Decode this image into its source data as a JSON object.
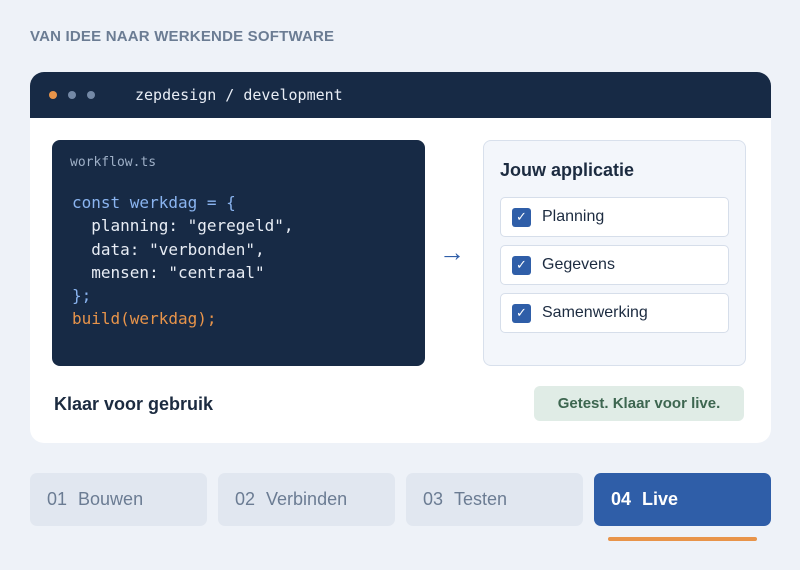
{
  "eyebrow": "VAN IDEE NAAR WERKENDE SOFTWARE",
  "window": {
    "path": "zepdesign / development"
  },
  "code": {
    "filename": "workflow.ts",
    "line1": "const werkdag = {",
    "line2": "  planning: \"geregeld\",",
    "line3": "  data: \"verbonden\",",
    "line4": "  mensen: \"centraal\"",
    "line5": "};",
    "line6": "build(werkdag);"
  },
  "arrow": "→",
  "app": {
    "heading": "Jouw applicatie",
    "items": [
      {
        "label": "Planning",
        "checked": true
      },
      {
        "label": "Gegevens",
        "checked": true
      },
      {
        "label": "Samenwerking",
        "checked": true
      }
    ]
  },
  "status": {
    "text": "Klaar voor gebruik",
    "badge": "Getest. Klaar voor live."
  },
  "steps": [
    {
      "num": "01",
      "label": "Bouwen",
      "active": false
    },
    {
      "num": "02",
      "label": "Verbinden",
      "active": false
    },
    {
      "num": "03",
      "label": "Testen",
      "active": false
    },
    {
      "num": "04",
      "label": "Live",
      "active": true
    }
  ],
  "colors": {
    "background": "#eef2f8",
    "dark": "#172a45",
    "accent_blue": "#2f5ea8",
    "accent_orange": "#e8944a",
    "success_bg": "#e0ece6",
    "success_text": "#3d6650"
  },
  "icons": {
    "window_dots": [
      "dot-orange",
      "dot-grey",
      "dot-grey"
    ],
    "checkbox": "checkmark-icon",
    "arrow": "arrow-right-icon"
  }
}
